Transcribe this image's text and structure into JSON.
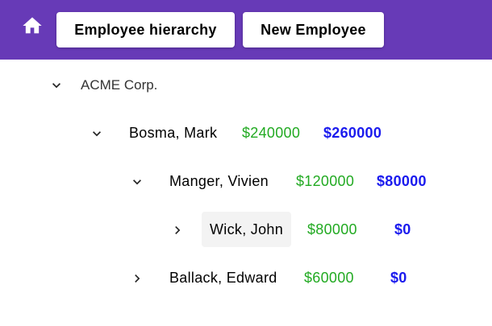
{
  "toolbar": {
    "home_icon": "home-icon",
    "hierarchy_label": "Employee hierarchy",
    "new_employee_label": "New Employee"
  },
  "colors": {
    "toolbar": "#673ab7",
    "salary": "#22aa22",
    "budget": "#1a1aee"
  },
  "tree": {
    "org": {
      "label": "ACME Corp.",
      "expanded": true
    },
    "employees": [
      {
        "name": "Bosma, Mark",
        "salary": "$240000",
        "budget": "$260000",
        "expanded": true
      },
      {
        "name": "Manger, Vivien",
        "salary": "$120000",
        "budget": "$80000",
        "expanded": true
      },
      {
        "name": "Wick, John",
        "salary": "$80000",
        "budget": "$0",
        "expanded": false,
        "selected": true
      },
      {
        "name": "Ballack, Edward",
        "salary": "$60000",
        "budget": "$0",
        "expanded": false
      }
    ]
  }
}
